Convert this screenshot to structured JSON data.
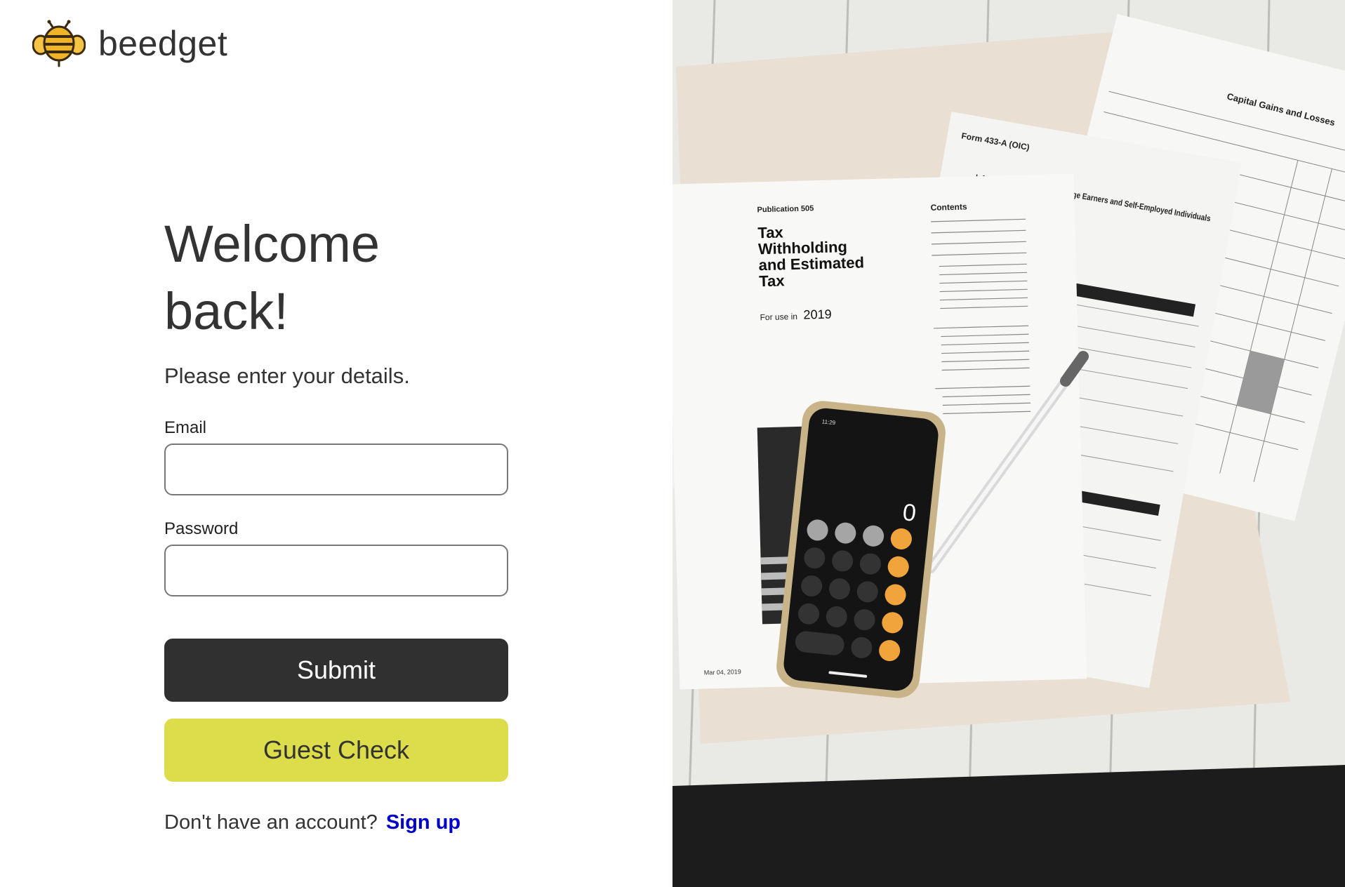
{
  "brand": {
    "name": "beedget",
    "logo_icon": "bee-icon"
  },
  "login": {
    "title": "Welcome back!",
    "subtitle": "Please enter your details.",
    "email_label": "Email",
    "email_value": "",
    "password_label": "Password",
    "password_value": "",
    "submit_label": "Submit",
    "guest_label": "Guest Check",
    "signup_prompt": "Don't have an account?",
    "signup_link": "Sign up"
  },
  "photo": {
    "publication": "Publication 505",
    "doc_title": [
      "Tax",
      "Withholding",
      "and Estimated",
      "Tax"
    ],
    "for_use_in": "For use in",
    "year": "2019",
    "contents": "Contents",
    "schedule_title": "Capital Gains and Losses",
    "form_433": "Form 433-A (OIC)",
    "info_statement": "Information Statement for Wage Earners and Self-Employed Individuals",
    "date_printed": "Mar 04, 2019",
    "calc_display": "0",
    "calc_time": "11:29"
  },
  "colors": {
    "button_dark": "#303030",
    "button_guest": "#dddd4b",
    "link": "#0000cc",
    "bee_yellow": "#f0b429"
  }
}
